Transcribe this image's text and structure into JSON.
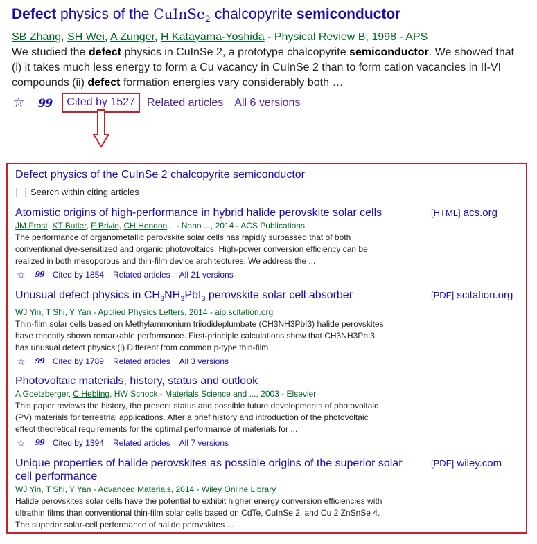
{
  "top_result": {
    "title_word1": "Defect",
    "title_mid": " physics of the ",
    "title_formula": "CuInSe",
    "title_formula_sub": "2",
    "title_mid2": " chalcopyrite ",
    "title_word_end": "semiconductor",
    "authors": [
      "SB Zhang",
      "SH Wei",
      "A Zunger",
      "H Katayama-Yoshida"
    ],
    "source": " - Physical Review B, 1998 - APS",
    "snippet_parts": {
      "p1": "We studied the ",
      "b1": "defect",
      "p2": " physics in CuInSe 2, a prototype chalcopyrite ",
      "b2": "semiconductor",
      "p3": ". We showed that (i) it takes much less energy to form a Cu vacancy in CuInSe 2 than to form cation vacancies in II-VI compounds (ii) ",
      "b3": "defect",
      "p4": " formation energies vary considerably both …"
    },
    "actions": {
      "star_icon": "star-icon",
      "cite_icon": "quote-icon",
      "cited_by": "Cited by 1527",
      "related": "Related articles",
      "versions": "All 6 versions"
    }
  },
  "arrow": {
    "icon": "down-arrow-icon",
    "color": "#c8202a"
  },
  "citing_panel": {
    "title": "Defect physics of the CuInSe 2 chalcopyrite semiconductor",
    "search_within_label": "Search within citing articles",
    "search_within_checked": false,
    "results": [
      {
        "title": "Atomistic origins of high-performance in hybrid halide perovskite solar cells",
        "side_tag": "[HTML]",
        "side_domain": "acs.org",
        "authors": [
          "JM Frost",
          "KT Butler",
          "F Brivio",
          "CH Hendon"
        ],
        "authors_suffix": "...",
        "source": " - Nano ..., 2014 - ACS Publications",
        "snippet": "The performance of organometallic perovskite solar cells has rapidly surpassed that of both conventional dye-sensitized and organic photovoltaics. High-power conversion efficiency can be realized in both mesoporous and thin-film device architectures. We address the ...",
        "cited_by": "Cited by 1854",
        "related": "Related articles",
        "versions": "All 21 versions"
      },
      {
        "title_pre": "Unusual defect physics in CH",
        "title_s1": "3",
        "title_m1": "NH",
        "title_s2": "3",
        "title_m2": "PbI",
        "title_s3": "3",
        "title_post": " perovskite solar cell absorber",
        "side_tag": "[PDF]",
        "side_domain": "scitation.org",
        "authors": [
          "WJ Yin",
          "T Shi",
          "Y Yan"
        ],
        "source": " - Applied Physics Letters, 2014 - aip.scitation.org",
        "snippet": "Thin-film solar cells based on Methylammonium triiodideplumbate (CH3NH3PbI3) halide perovskites have recently shown remarkable performance. First-principle calculations show that CH3NH3PbI3 has unusual defect physics:(i) Different from common p-type thin-film ...",
        "cited_by": "Cited by 1789",
        "related": "Related articles",
        "versions": "All 3 versions"
      },
      {
        "title": "Photovoltaic materials, history, status and outlook",
        "author_plain1": "A Goetzberger, ",
        "author_link": "C Hebling",
        "author_plain2": ", HW Schock",
        "source": " - Materials Science and ..., 2003 - Elsevier",
        "snippet": "This paper reviews the history, the present status and possible future developments of photovoltaic (PV) materials for terrestrial applications. After a brief history and introduction of the photovoltaic effect theoretical requirements for the optimal performance of materials for ...",
        "cited_by": "Cited by 1394",
        "related": "Related articles",
        "versions": "All 7 versions"
      },
      {
        "title": "Unique properties of halide perovskites as possible origins of the superior solar cell performance",
        "side_tag": "[PDF]",
        "side_domain": "wiley.com",
        "authors": [
          "WJ Yin",
          "T Shi",
          "Y Yan"
        ],
        "source": " - Advanced Materials, 2014 - Wiley Online Library",
        "snippet": "Halide perovskites solar cells have the potential to exhibit higher energy conversion efficiencies with ultrathin films than conventional thin-film solar cells based on CdTe, CuInSe 2, and Cu 2 ZnSnSe 4. The superior solar-cell performance of halide perovskites ..."
      }
    ]
  },
  "colors": {
    "link_blue": "#1a0dab",
    "visited_purple": "#4b2497",
    "author_green": "#006621",
    "highlight_red": "#c8202a"
  }
}
